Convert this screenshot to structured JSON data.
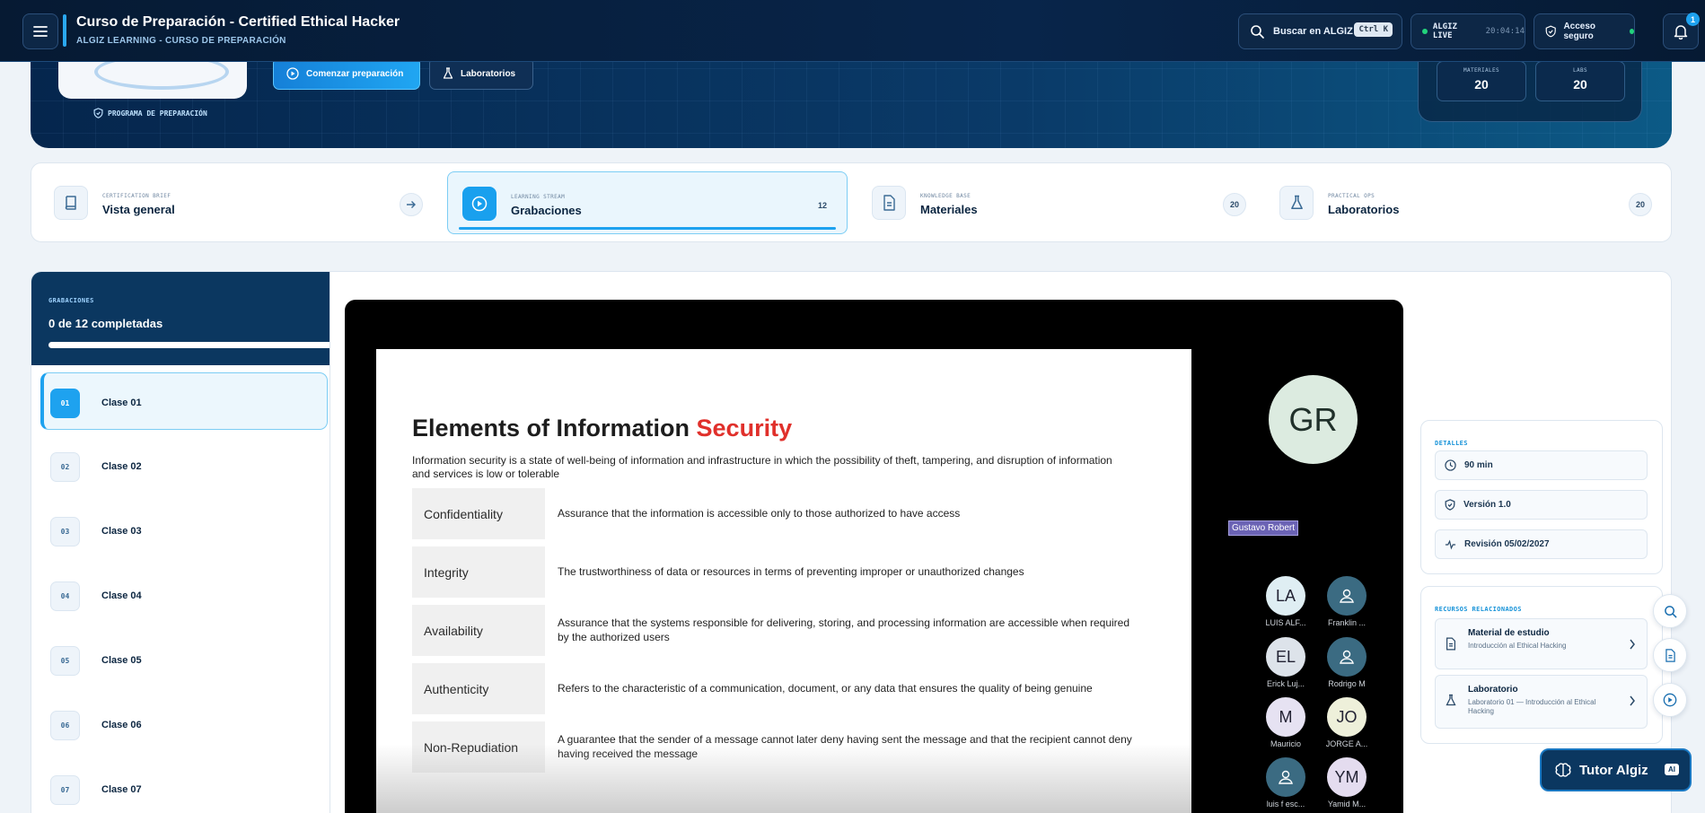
{
  "header": {
    "title": "Curso de Preparación - Certified Ethical Hacker",
    "subtitle": "ALGIZ LEARNING - CURSO DE PREPARACIÓN",
    "search_label": "Buscar en ALGIZ",
    "search_shortcut": "Ctrl K",
    "live_label": "ALGIZ LIVE",
    "live_time": "20:04:14",
    "secure_label": "Acceso seguro",
    "notification_count": "1"
  },
  "hero": {
    "program_label": "PROGRAMA DE PREPARACIÓN",
    "start_button": "Comenzar preparación",
    "labs_button": "Laboratorios",
    "stats": [
      {
        "label": "MATERIALES",
        "value": "20"
      },
      {
        "label": "LABS",
        "value": "20"
      }
    ]
  },
  "tabs": [
    {
      "eyebrow": "CERTIFICATION BRIEF",
      "label": "Vista general",
      "icon": "book-icon"
    },
    {
      "eyebrow": "LEARNING STREAM",
      "label": "Grabaciones",
      "count": "12",
      "icon": "play-icon"
    },
    {
      "eyebrow": "KNOWLEDGE BASE",
      "label": "Materiales",
      "count": "20",
      "icon": "document-icon"
    },
    {
      "eyebrow": "PRACTICAL OPS",
      "label": "Laboratorios",
      "count": "20",
      "icon": "flask-icon"
    }
  ],
  "sidebar": {
    "eyebrow": "GRABACIONES",
    "progress_text": "0 de 12 completadas",
    "progress": 0,
    "classes": [
      {
        "num": "01",
        "title": "Clase 01"
      },
      {
        "num": "02",
        "title": "Clase 02"
      },
      {
        "num": "03",
        "title": "Clase 03"
      },
      {
        "num": "04",
        "title": "Clase 04"
      },
      {
        "num": "05",
        "title": "Clase 05"
      },
      {
        "num": "06",
        "title": "Clase 06"
      },
      {
        "num": "07",
        "title": "Clase 07"
      }
    ]
  },
  "video": {
    "slide": {
      "title_main": "Elements of Information ",
      "title_accent": "Security",
      "intro": "Information security is a state of well-being of information and infrastructure in which the possibility of theft, tampering, and disruption of information and services is low or tolerable",
      "rows": [
        {
          "term": "Confidentiality",
          "desc": "Assurance that the information is accessible only to those authorized to have access"
        },
        {
          "term": "Integrity",
          "desc": "The trustworthiness of data or resources in terms of preventing improper or unauthorized changes"
        },
        {
          "term": "Availability",
          "desc": "Assurance that the systems responsible for delivering, storing, and processing information are accessible when required by the authorized users"
        },
        {
          "term": "Authenticity",
          "desc": "Refers to the characteristic of a communication, document, or any data that ensures the quality of being genuine"
        },
        {
          "term": "Non-Repudiation",
          "desc": "A guarantee that the sender of a message cannot later deny having sent the message and that the recipient cannot deny having received the message"
        }
      ]
    },
    "presenter_initials": "GR",
    "presenter_name": "Gustavo Robert",
    "participants": [
      {
        "initials": "LA",
        "name": "LUIS ALF...",
        "color": "#dfeef3"
      },
      {
        "initials": "",
        "name": "Franklin ...",
        "color": "#3b6b82"
      },
      {
        "initials": "EL",
        "name": "Erick Luj...",
        "color": "#dde3ea"
      },
      {
        "initials": "",
        "name": "Rodrigo M",
        "color": "#3b6b82"
      },
      {
        "initials": "M",
        "name": "Mauricio",
        "color": "#e6e2f2"
      },
      {
        "initials": "JO",
        "name": "JORGE A...",
        "color": "#eef0da"
      },
      {
        "initials": "",
        "name": "luis f esc...",
        "color": "#3b6b82"
      },
      {
        "initials": "YM",
        "name": "Yamid M...",
        "color": "#e4dcef"
      }
    ]
  },
  "details": {
    "title": "DETALLES",
    "items": [
      "90 min",
      "Versión 1.0",
      "Revisión 05/02/2027"
    ]
  },
  "resources": {
    "title": "RECURSOS RELACIONADOS",
    "items": [
      {
        "title": "Material de estudio",
        "subtitle": "Introducción al Ethical Hacking"
      },
      {
        "title": "Laboratorio",
        "subtitle": "Laboratorio 01 — Introducción al Ethical Hacking"
      }
    ]
  },
  "tutor": {
    "label": "Tutor Algiz",
    "badge": "AI"
  },
  "colors": {
    "accent": "#1ea2ef",
    "navy": "#061a33",
    "slide_accent": "#e0302b"
  }
}
